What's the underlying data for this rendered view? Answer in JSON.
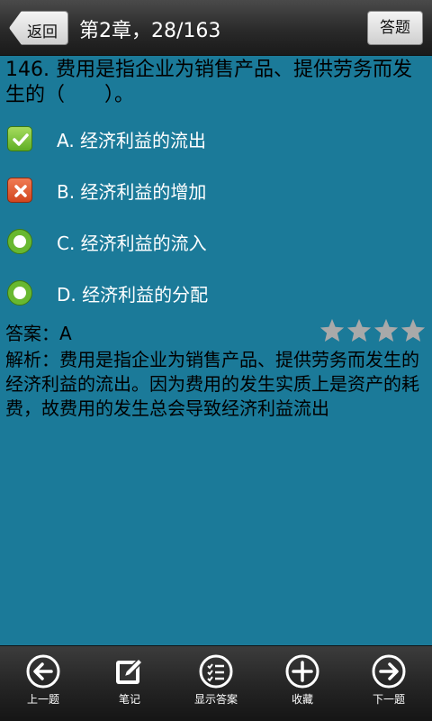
{
  "header": {
    "back_label": "返回",
    "title": "第2章，28/163",
    "answer_label": "答题"
  },
  "question": {
    "text": "146. 费用是指企业为销售产品、提供劳务而发生的（　　）。",
    "options": [
      {
        "label": "A. 经济利益的流出",
        "state": "correct"
      },
      {
        "label": "B. 经济利益的增加",
        "state": "wrong"
      },
      {
        "label": "C. 经济利益的流入",
        "state": "unselected"
      },
      {
        "label": "D. 经济利益的分配",
        "state": "unselected"
      }
    ]
  },
  "answer": "答案：A",
  "rating": {
    "stars": 4,
    "max": 4
  },
  "analysis": "解析：费用是指企业为销售产品、提供劳务而发生的经济利益的流出。因为费用的发生实质上是资产的耗费，故费用的发生总会导致经济利益流出",
  "bottom_nav": [
    {
      "label": "上一题",
      "icon": "arrow-left-circle-icon"
    },
    {
      "label": "笔记",
      "icon": "note-edit-icon"
    },
    {
      "label": "显示答案",
      "icon": "list-check-icon"
    },
    {
      "label": "收藏",
      "icon": "plus-circle-icon"
    },
    {
      "label": "下一题",
      "icon": "arrow-right-circle-icon"
    }
  ],
  "colors": {
    "background": "#1b7a99",
    "correct": "#68b830",
    "wrong": "#d2461e",
    "star": "#a9a9a9"
  }
}
